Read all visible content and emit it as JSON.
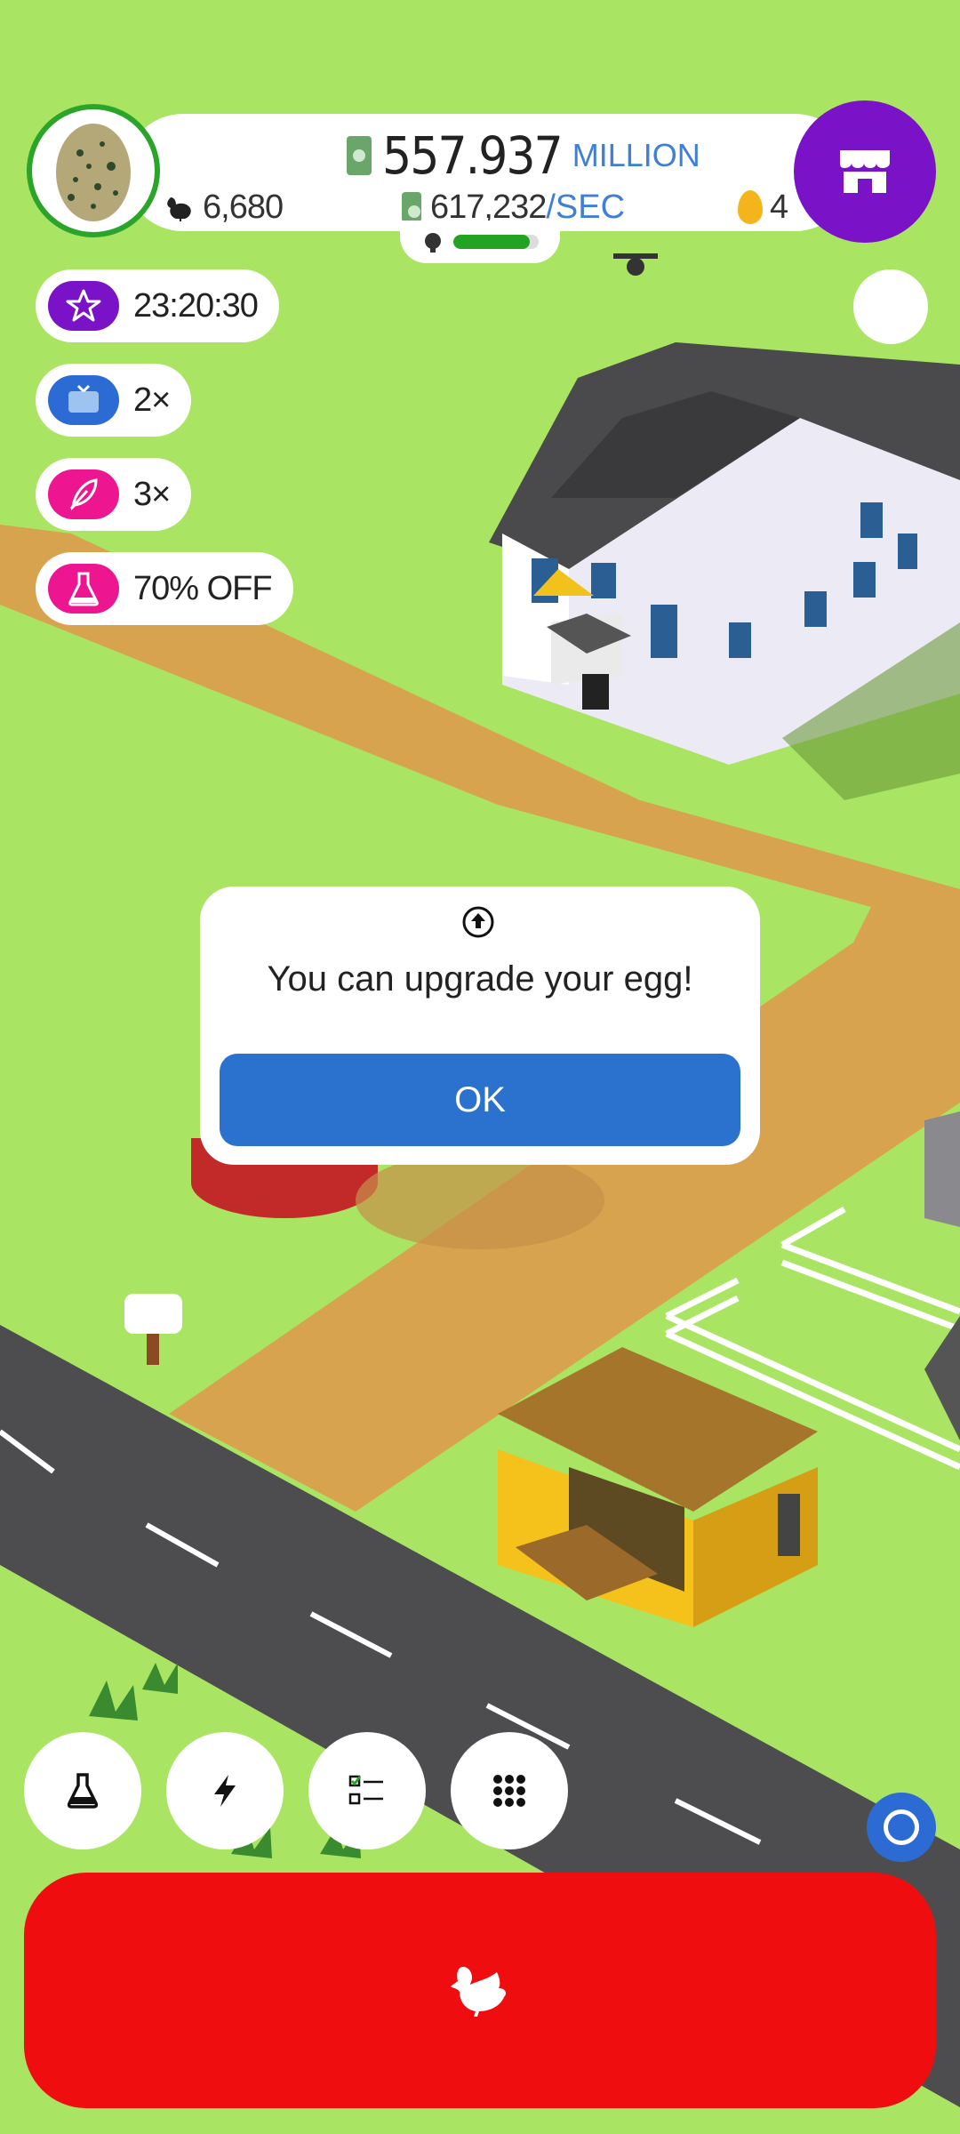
{
  "colors": {
    "grass": "#a9e463",
    "road": "#4d4d4f",
    "path": "#d8a34f",
    "shop": "#7a12c7",
    "ok": "#2a72cd",
    "hatch": "#ef0d10"
  },
  "stats": {
    "money_value": "557.937",
    "money_unit": "MILLION",
    "rate_value": "617,232",
    "rate_unit": "/SEC",
    "hens": "6,680",
    "golden_eggs": "4",
    "progress": 0.9
  },
  "boosts": [
    {
      "icon": "star-icon",
      "text": "23:20:30",
      "color": "#7a12c7"
    },
    {
      "icon": "tv-icon",
      "text": "2×",
      "color": "#2d6bd4"
    },
    {
      "icon": "feather-icon",
      "text": "3×",
      "color": "#ee1590"
    },
    {
      "icon": "flask-icon",
      "text": "70% OFF",
      "color": "#ee1590"
    }
  ],
  "dialog": {
    "message": "You can upgrade your egg!",
    "ok_label": "OK",
    "icon": "upgrade-arrow-icon"
  },
  "toolbar": [
    {
      "icon": "flask-icon"
    },
    {
      "icon": "lightning-icon"
    },
    {
      "icon": "checklist-icon"
    },
    {
      "icon": "grid-icon"
    }
  ],
  "hatch": {
    "icon": "chicken-icon"
  }
}
